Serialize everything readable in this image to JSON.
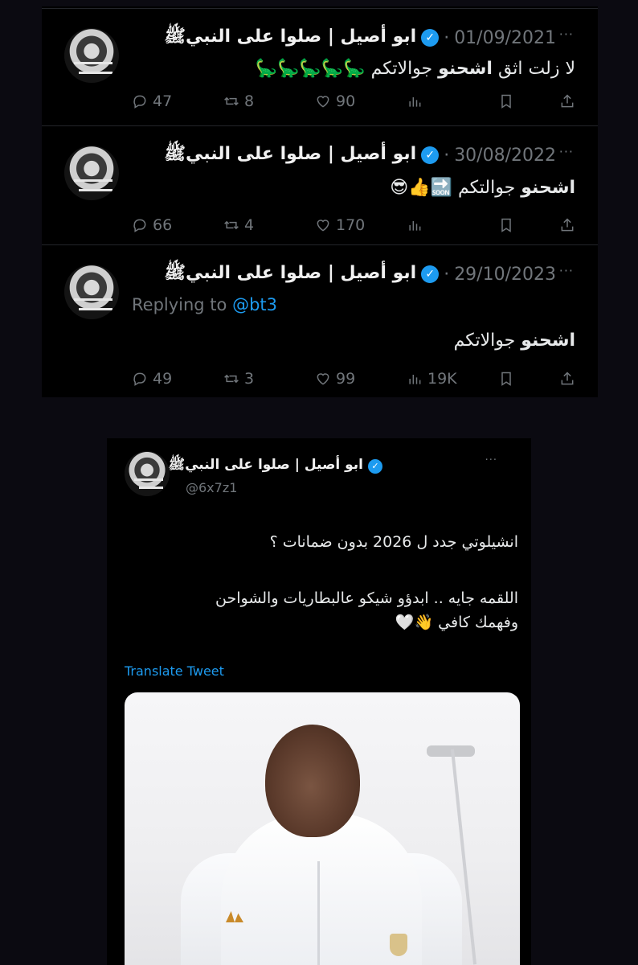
{
  "feed": {
    "tweets": [
      {
        "username": "ابو أصيل | صلوا على النبيﷺ",
        "separator": "·",
        "date": "01/09/2021",
        "text_plain": "لا زلت اثق ",
        "text_bold": "اشحنو",
        "text_tail": " جوالاتكم",
        "emoji": "🦕🦕🦕🦕🦕",
        "replies": "47",
        "retweets": "8",
        "likes": "90",
        "views": ""
      },
      {
        "username": "ابو أصيل | صلوا على النبيﷺ",
        "separator": "·",
        "date": "30/08/2022",
        "text_plain": "",
        "text_bold": "اشحنو",
        "text_tail": " جوالتكم",
        "emoji": "🔜👍😎",
        "replies": "66",
        "retweets": "4",
        "likes": "170",
        "views": ""
      },
      {
        "username": "ابو أصيل | صلوا على النبيﷺ",
        "separator": "·",
        "date": "29/10/2023",
        "replying_prefix": "Replying to",
        "replying_handle": "@bt3",
        "text_plain": "",
        "text_bold": "اشحنو",
        "text_tail": " جوالاتكم",
        "emoji": "",
        "replies": "49",
        "retweets": "3",
        "likes": "99",
        "views": "19K"
      }
    ],
    "more": "···"
  },
  "card": {
    "username": "ابو أصيل | صلوا على النبيﷺ",
    "handle": "@6x7z1",
    "more": "···",
    "line1": "انشيلوتي جدد ل 2026 بدون ضمانات ؟",
    "line2": "اللقمه جايه .. ابدؤو شيكو عالبطاريات والشواحن",
    "line3": "وفهمك كافي 👋🤍",
    "translate": "Translate Tweet"
  },
  "icons": {
    "verified": "verified-badge-icon",
    "reply": "reply-icon",
    "retweet": "retweet-icon",
    "like": "heart-icon",
    "views": "views-chart-icon",
    "bookmark": "bookmark-icon",
    "share": "share-icon"
  },
  "colors": {
    "accent": "#1d9bf0",
    "muted": "#71767b",
    "background": "#000000"
  }
}
